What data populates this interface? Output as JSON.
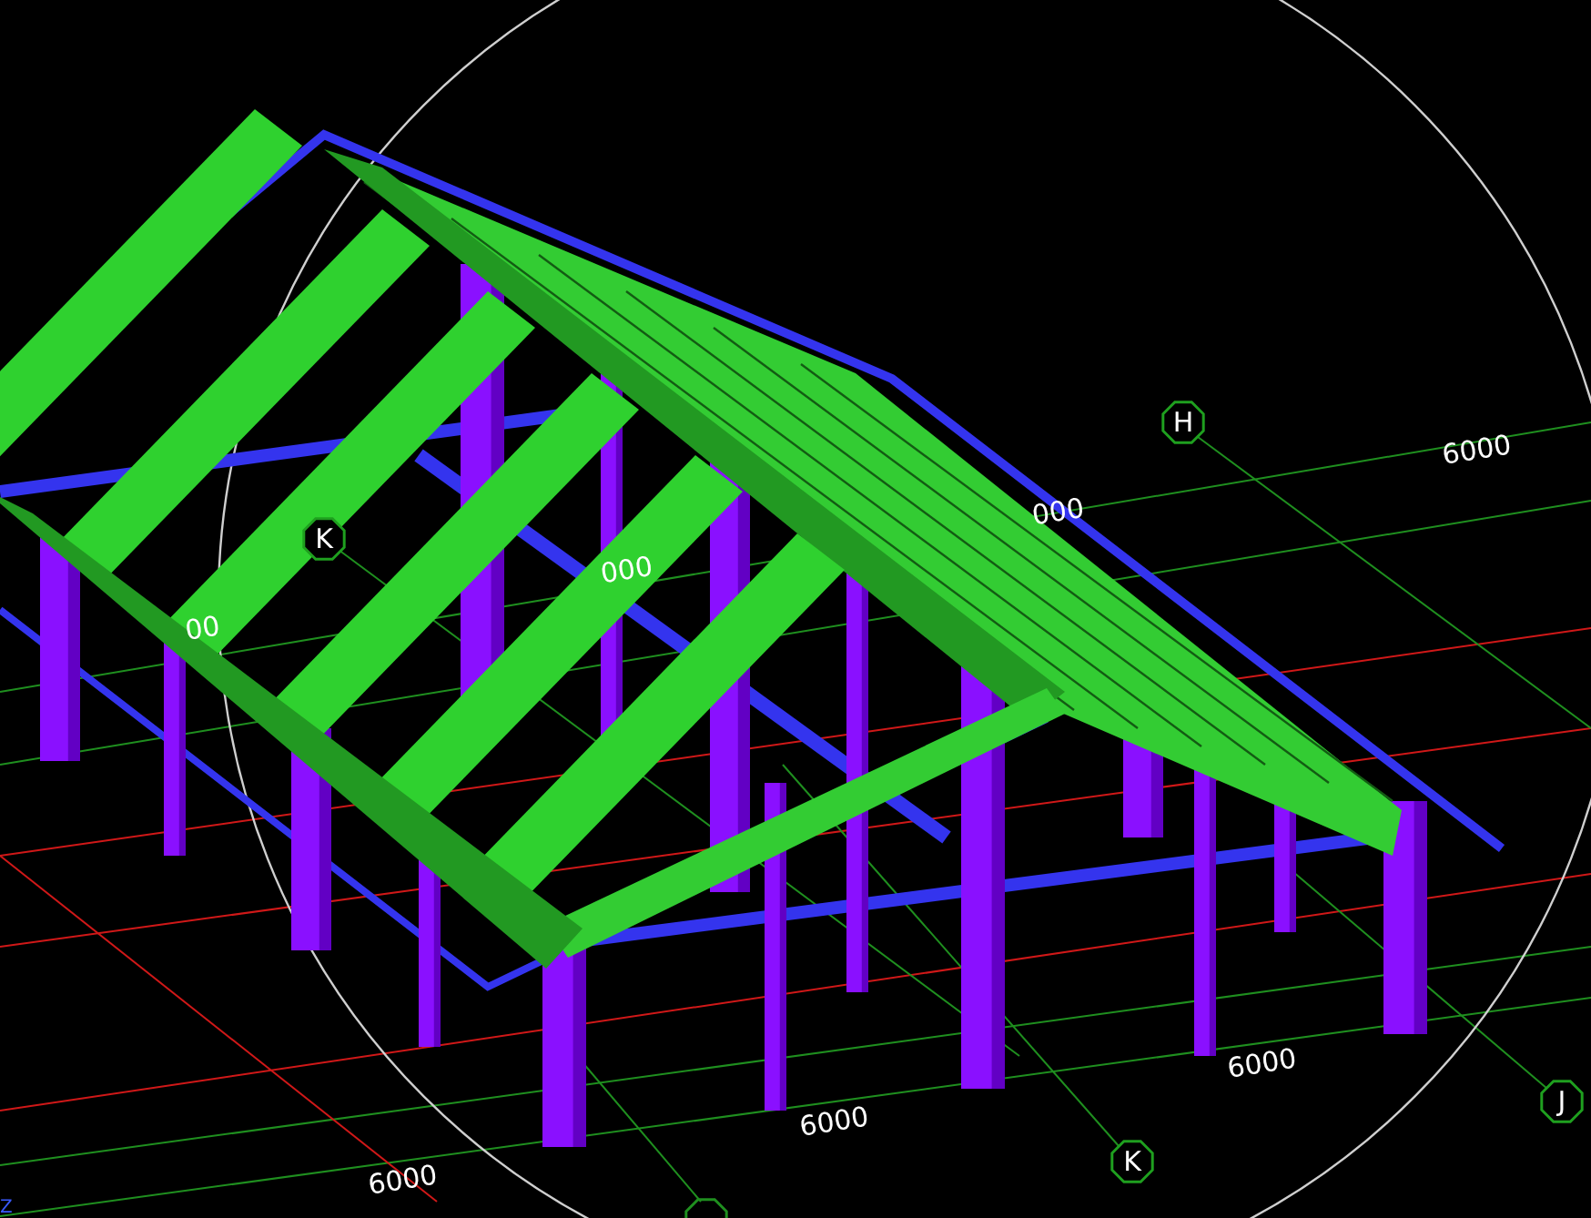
{
  "viewport": {
    "grid_labels": [
      {
        "text": "H"
      },
      {
        "text": "K"
      },
      {
        "text": "K"
      },
      {
        "text": "J"
      }
    ],
    "dimension_labels": [
      {
        "text": "6000"
      },
      {
        "text": "000"
      },
      {
        "text": "000"
      },
      {
        "text": "00"
      },
      {
        "text": "6000"
      },
      {
        "text": "6000"
      },
      {
        "text": "6000"
      }
    ],
    "axis_label": "Z"
  }
}
